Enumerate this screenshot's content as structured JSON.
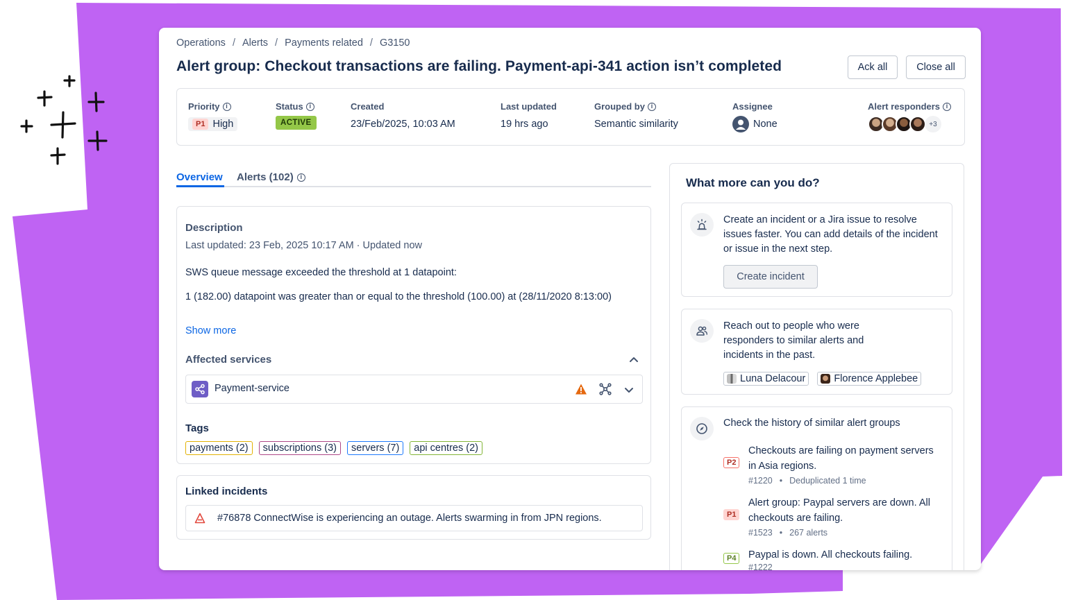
{
  "breadcrumb": [
    "Operations",
    "Alerts",
    "Payments related",
    "G3150"
  ],
  "page_title": "Alert group: Checkout transactions are failing. Payment-api-341 action isn’t completed",
  "actions": {
    "ack_all": "Ack all",
    "close_all": "Close all"
  },
  "meta": {
    "priority_label": "Priority",
    "priority_badge": "P1",
    "priority_value": "High",
    "status_label": "Status",
    "status_value": "ACTIVE",
    "created_label": "Created",
    "created_value": "23/Feb/2025, 10:03 AM",
    "last_updated_label": "Last updated",
    "last_updated_value": "19 hrs ago",
    "grouped_by_label": "Grouped by",
    "grouped_by_value": "Semantic similarity",
    "assignee_label": "Assignee",
    "assignee_value": "None",
    "responders_label": "Alert responders",
    "responders_more": "+3"
  },
  "tabs": [
    {
      "label": "Overview",
      "active": true
    },
    {
      "label": "Alerts (102)",
      "active": false
    }
  ],
  "description": {
    "heading": "Description",
    "updated": "Last updated: 23 Feb, 2025 10:17 AM  ·  Updated now",
    "line1": "SWS queue message exceeded the threshold at 1 datapoint:",
    "line2": "1 (182.00) datapoint was greater than or equal to the threshold (100.00) at (28/11/2020 8:13:00)",
    "show_more": "Show more"
  },
  "affected": {
    "label": "Affected services",
    "service": "Payment-service"
  },
  "tags": {
    "label": "Tags",
    "items": [
      {
        "label": "payments (2)",
        "color": "#e2b203"
      },
      {
        "label": "subscriptions (3)",
        "color": "#ae4787"
      },
      {
        "label": "servers (7)",
        "color": "#1d7afc"
      },
      {
        "label": "api centres (2)",
        "color": "#82b536"
      }
    ]
  },
  "linked": {
    "heading": "Linked incidents",
    "item": "#76878 ConnectWise is experiencing an outage. Alerts swarming in from JPN regions."
  },
  "side": {
    "title": "What more can you do?",
    "incident_text": "Create an incident or a Jira issue to resolve issues faster. You can add details of the incident or issue in the next step.",
    "incident_button": "Create incident",
    "people_text": "Reach out to people who were responders to similar alerts and incidents in the past.",
    "people": [
      "Luna Delacour",
      "Florence Applebee"
    ],
    "history_text": "Check the history of similar alert groups",
    "history": [
      {
        "badge": "P2",
        "title": "Checkouts are failing on payment servers in Asia regions.",
        "id": "#1220",
        "detail": "Deduplicated 1 time"
      },
      {
        "badge": "P1",
        "title": "Alert group: Paypal servers are down. All checkouts are failing.",
        "id": "#1523",
        "detail": "267 alerts"
      },
      {
        "badge": "P4",
        "title": "Paypal is down. All checkouts failing.",
        "id": "#1222",
        "detail": ""
      }
    ]
  },
  "colors": {
    "background_accent": "#bf63f3",
    "link_blue": "#0c66e4",
    "active_green": "#94c748",
    "p1_red": "#ae2e24"
  }
}
